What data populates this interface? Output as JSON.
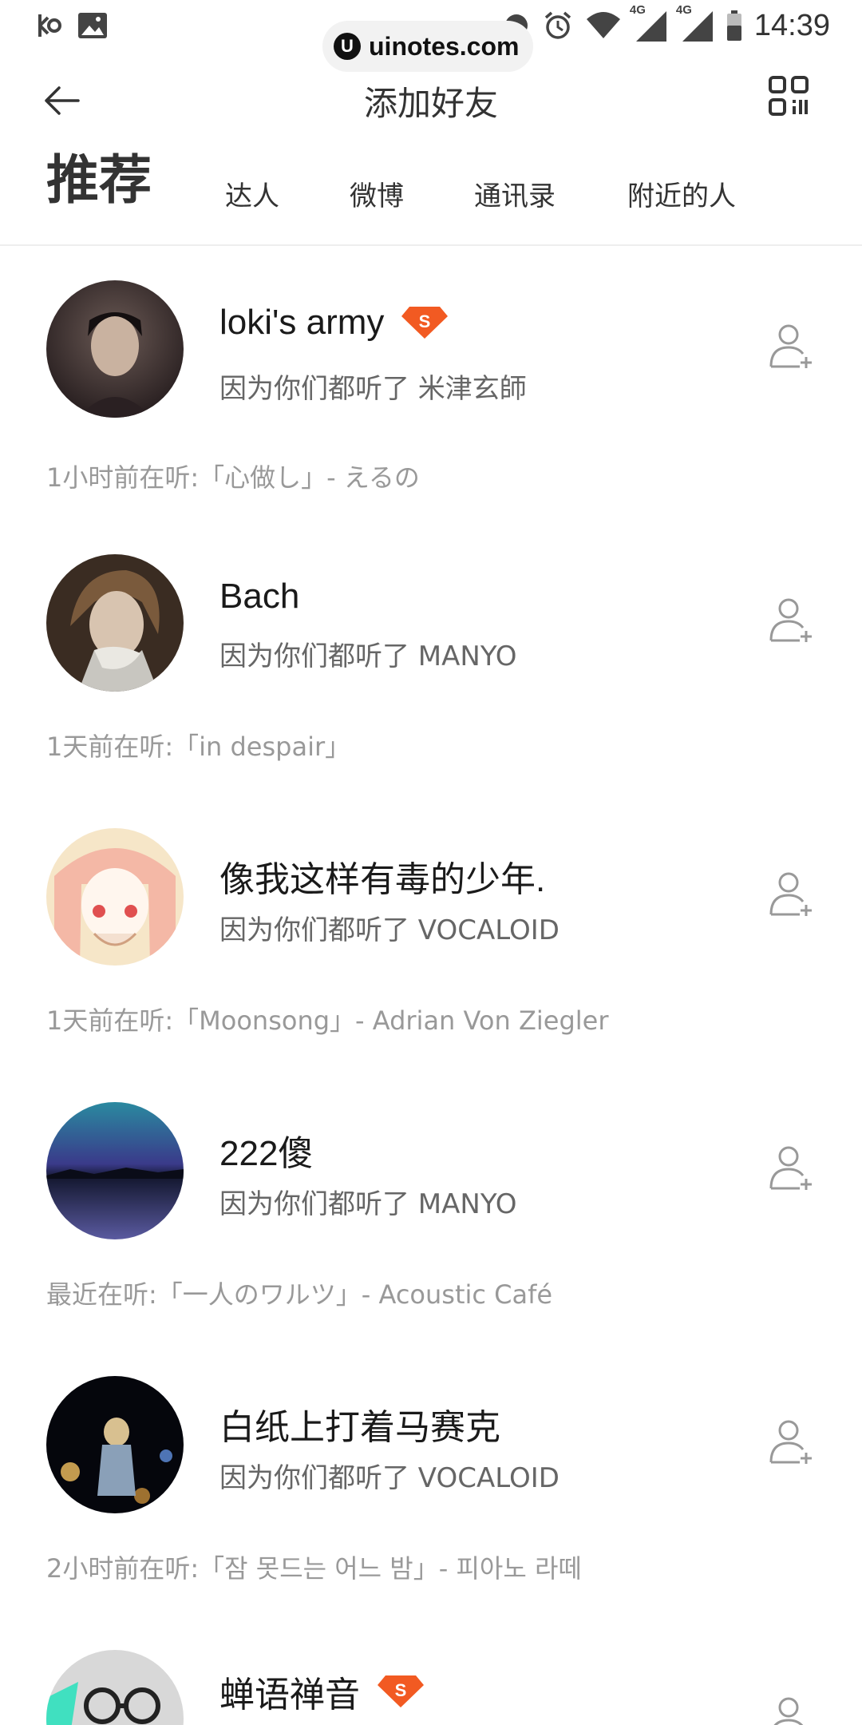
{
  "status_bar": {
    "time": "14:39",
    "network_1": "4G",
    "network_2": "4G"
  },
  "watermark": {
    "logo": "U",
    "text": "uinotes.com"
  },
  "header": {
    "title": "添加好友"
  },
  "tabs": [
    {
      "label": "推荐",
      "active": true
    },
    {
      "label": "达人"
    },
    {
      "label": "微博"
    },
    {
      "label": "通讯录"
    },
    {
      "label": "附近的人"
    }
  ],
  "recommendations": [
    {
      "name": "loki's army",
      "badge": "S",
      "reason": "因为你们都听了 米津玄師",
      "listening": "1小时前在听:「心做し」- えるの",
      "avatar_icon": "avatar-loki"
    },
    {
      "name": "Bach",
      "reason": "因为你们都听了 MANYO",
      "listening": "1天前在听:「in despair」",
      "avatar_icon": "avatar-bach"
    },
    {
      "name": "像我这样有毒的少年.",
      "reason": "因为你们都听了 VOCALOID",
      "listening": "1天前在听:「Moonsong」- Adrian Von Ziegler",
      "avatar_icon": "avatar-anime"
    },
    {
      "name": "222傻",
      "reason": "因为你们都听了 MANYO",
      "listening": "最近在听:「一人のワルツ」- Acoustic Café",
      "avatar_icon": "avatar-lake"
    },
    {
      "name": "白纸上打着马赛克",
      "reason": "因为你们都听了 VOCALOID",
      "listening": "2小时前在听:「잠 못드는 어느 밤」- 피아노 라떼",
      "avatar_icon": "avatar-night"
    },
    {
      "name": "蝉语禅音",
      "badge": "S",
      "reason": "",
      "listening": "",
      "avatar_icon": "avatar-glasses"
    }
  ],
  "colors": {
    "badge": "#f25a22",
    "accent_text": "#333333",
    "secondary_text": "#666666",
    "tertiary_text": "#999999"
  }
}
